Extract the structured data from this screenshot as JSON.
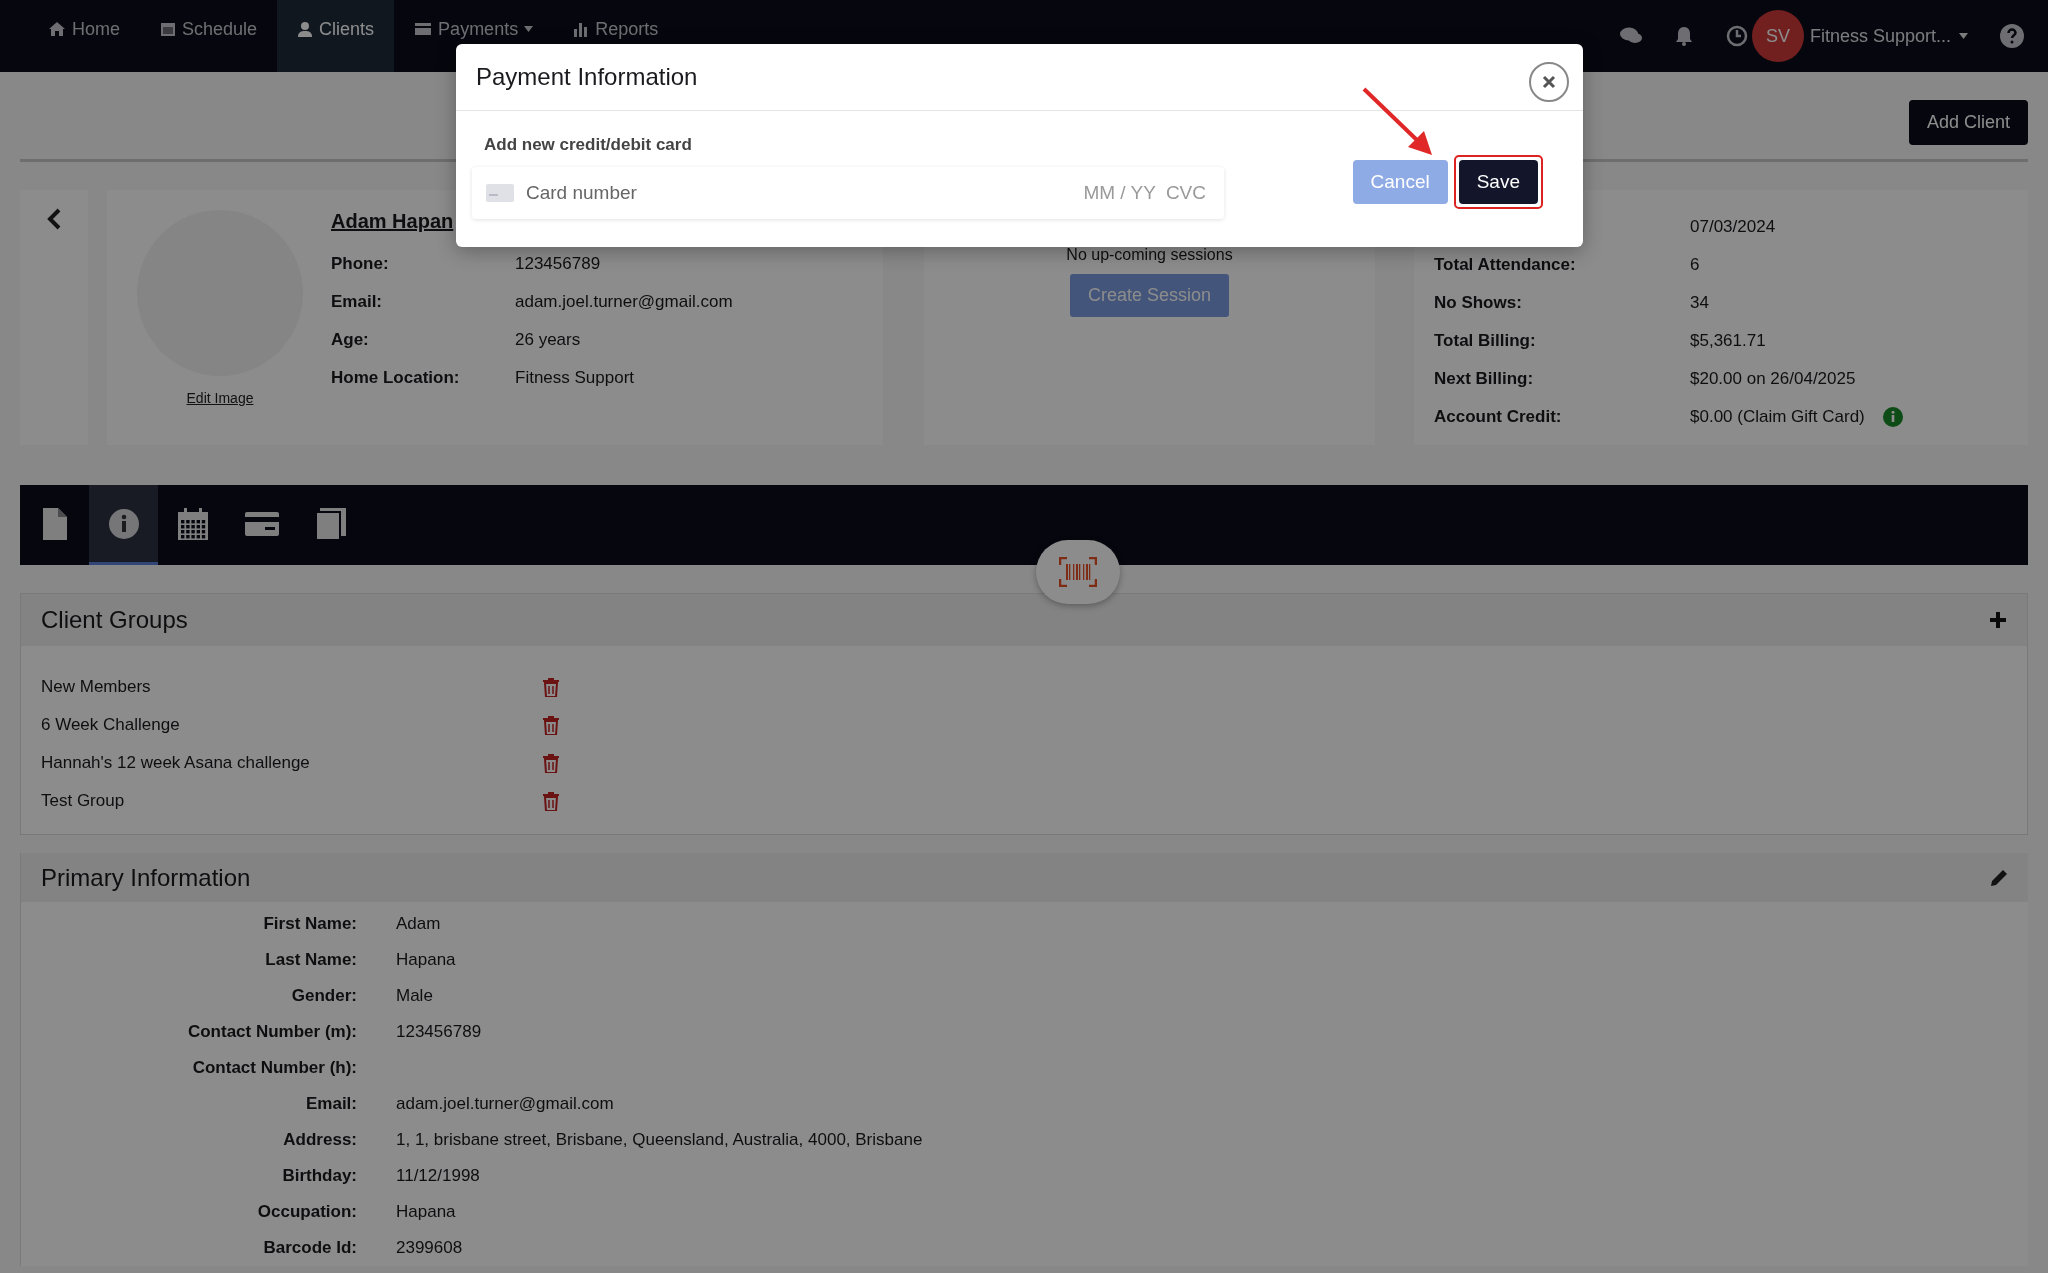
{
  "nav": {
    "items": [
      {
        "label": "Home",
        "kind": "home",
        "selected": false,
        "dropdown": false
      },
      {
        "label": "Schedule",
        "kind": "calendar",
        "selected": false,
        "dropdown": false
      },
      {
        "label": "Clients",
        "kind": "person",
        "selected": true,
        "dropdown": false
      },
      {
        "label": "Payments",
        "kind": "card",
        "selected": false,
        "dropdown": true
      },
      {
        "label": "Reports",
        "kind": "chart",
        "selected": false,
        "dropdown": false
      }
    ],
    "user": {
      "initials": "SV",
      "name": "Fitness Support..."
    }
  },
  "add_client_button": "Add Client",
  "profile": {
    "name": "Adam Hapan",
    "edit_image": "Edit Image",
    "fields": [
      {
        "label": "Phone:",
        "value": "123456789"
      },
      {
        "label": "Email:",
        "value": "adam.joel.turner@gmail.com"
      },
      {
        "label": "Age:",
        "value": "26 years"
      },
      {
        "label": "Home Location:",
        "value": "Fitness Support"
      }
    ]
  },
  "sessions": {
    "empty_text": "No up-coming sessions",
    "button": "Create Session"
  },
  "stats": {
    "rows": [
      {
        "value": "07/03/2024",
        "info": false
      },
      {
        "label": "Total Attendance:",
        "value": "6",
        "info": false
      },
      {
        "label": "No Shows:",
        "value": "34",
        "info": false
      },
      {
        "label": "Total Billing:",
        "value": "$5,361.71",
        "info": false
      },
      {
        "label": "Next Billing:",
        "value": "$20.00 on 26/04/2025",
        "info": false
      },
      {
        "label": "Account Credit:",
        "value": "$0.00 (Claim Gift Card)",
        "info": true
      }
    ]
  },
  "tabs": [
    {
      "kind": "document",
      "selected": false
    },
    {
      "kind": "info",
      "selected": true
    },
    {
      "kind": "calendar",
      "selected": false
    },
    {
      "kind": "card",
      "selected": false
    },
    {
      "kind": "book",
      "selected": false
    }
  ],
  "client_groups": {
    "title": "Client Groups",
    "groups": [
      "New Members",
      "6 Week Challenge",
      "Hannah's 12 week Asana challenge",
      "Test Group"
    ]
  },
  "primary_info": {
    "title": "Primary Information",
    "rows": [
      {
        "label": "First Name:",
        "value": "Adam"
      },
      {
        "label": "Last Name:",
        "value": "Hapana"
      },
      {
        "label": "Gender:",
        "value": "Male"
      },
      {
        "label": "Contact Number (m):",
        "value": "123456789"
      },
      {
        "label": "Contact Number (h):"
      },
      {
        "label": "Email:",
        "value": "adam.joel.turner@gmail.com"
      },
      {
        "label": "Address:",
        "value": "1, 1, brisbane street, Brisbane, Queensland, Australia, 4000, Brisbane"
      },
      {
        "label": "Birthday:",
        "value": "11/12/1998"
      },
      {
        "label": "Occupation:",
        "value": "Hapana"
      },
      {
        "label": "Barcode Id:",
        "value": "2399608"
      }
    ]
  },
  "modal": {
    "title": "Payment Information",
    "section_label": "Add new credit/debit card",
    "card_field": {
      "placeholder": "Card number",
      "expiry_placeholder": "MM / YY",
      "cvc_placeholder": "CVC"
    },
    "buttons": [
      {
        "label": "Cancel",
        "kind": "secondary",
        "highlighted": false
      },
      {
        "label": "Save",
        "kind": "primary",
        "highlighted": true
      }
    ]
  }
}
